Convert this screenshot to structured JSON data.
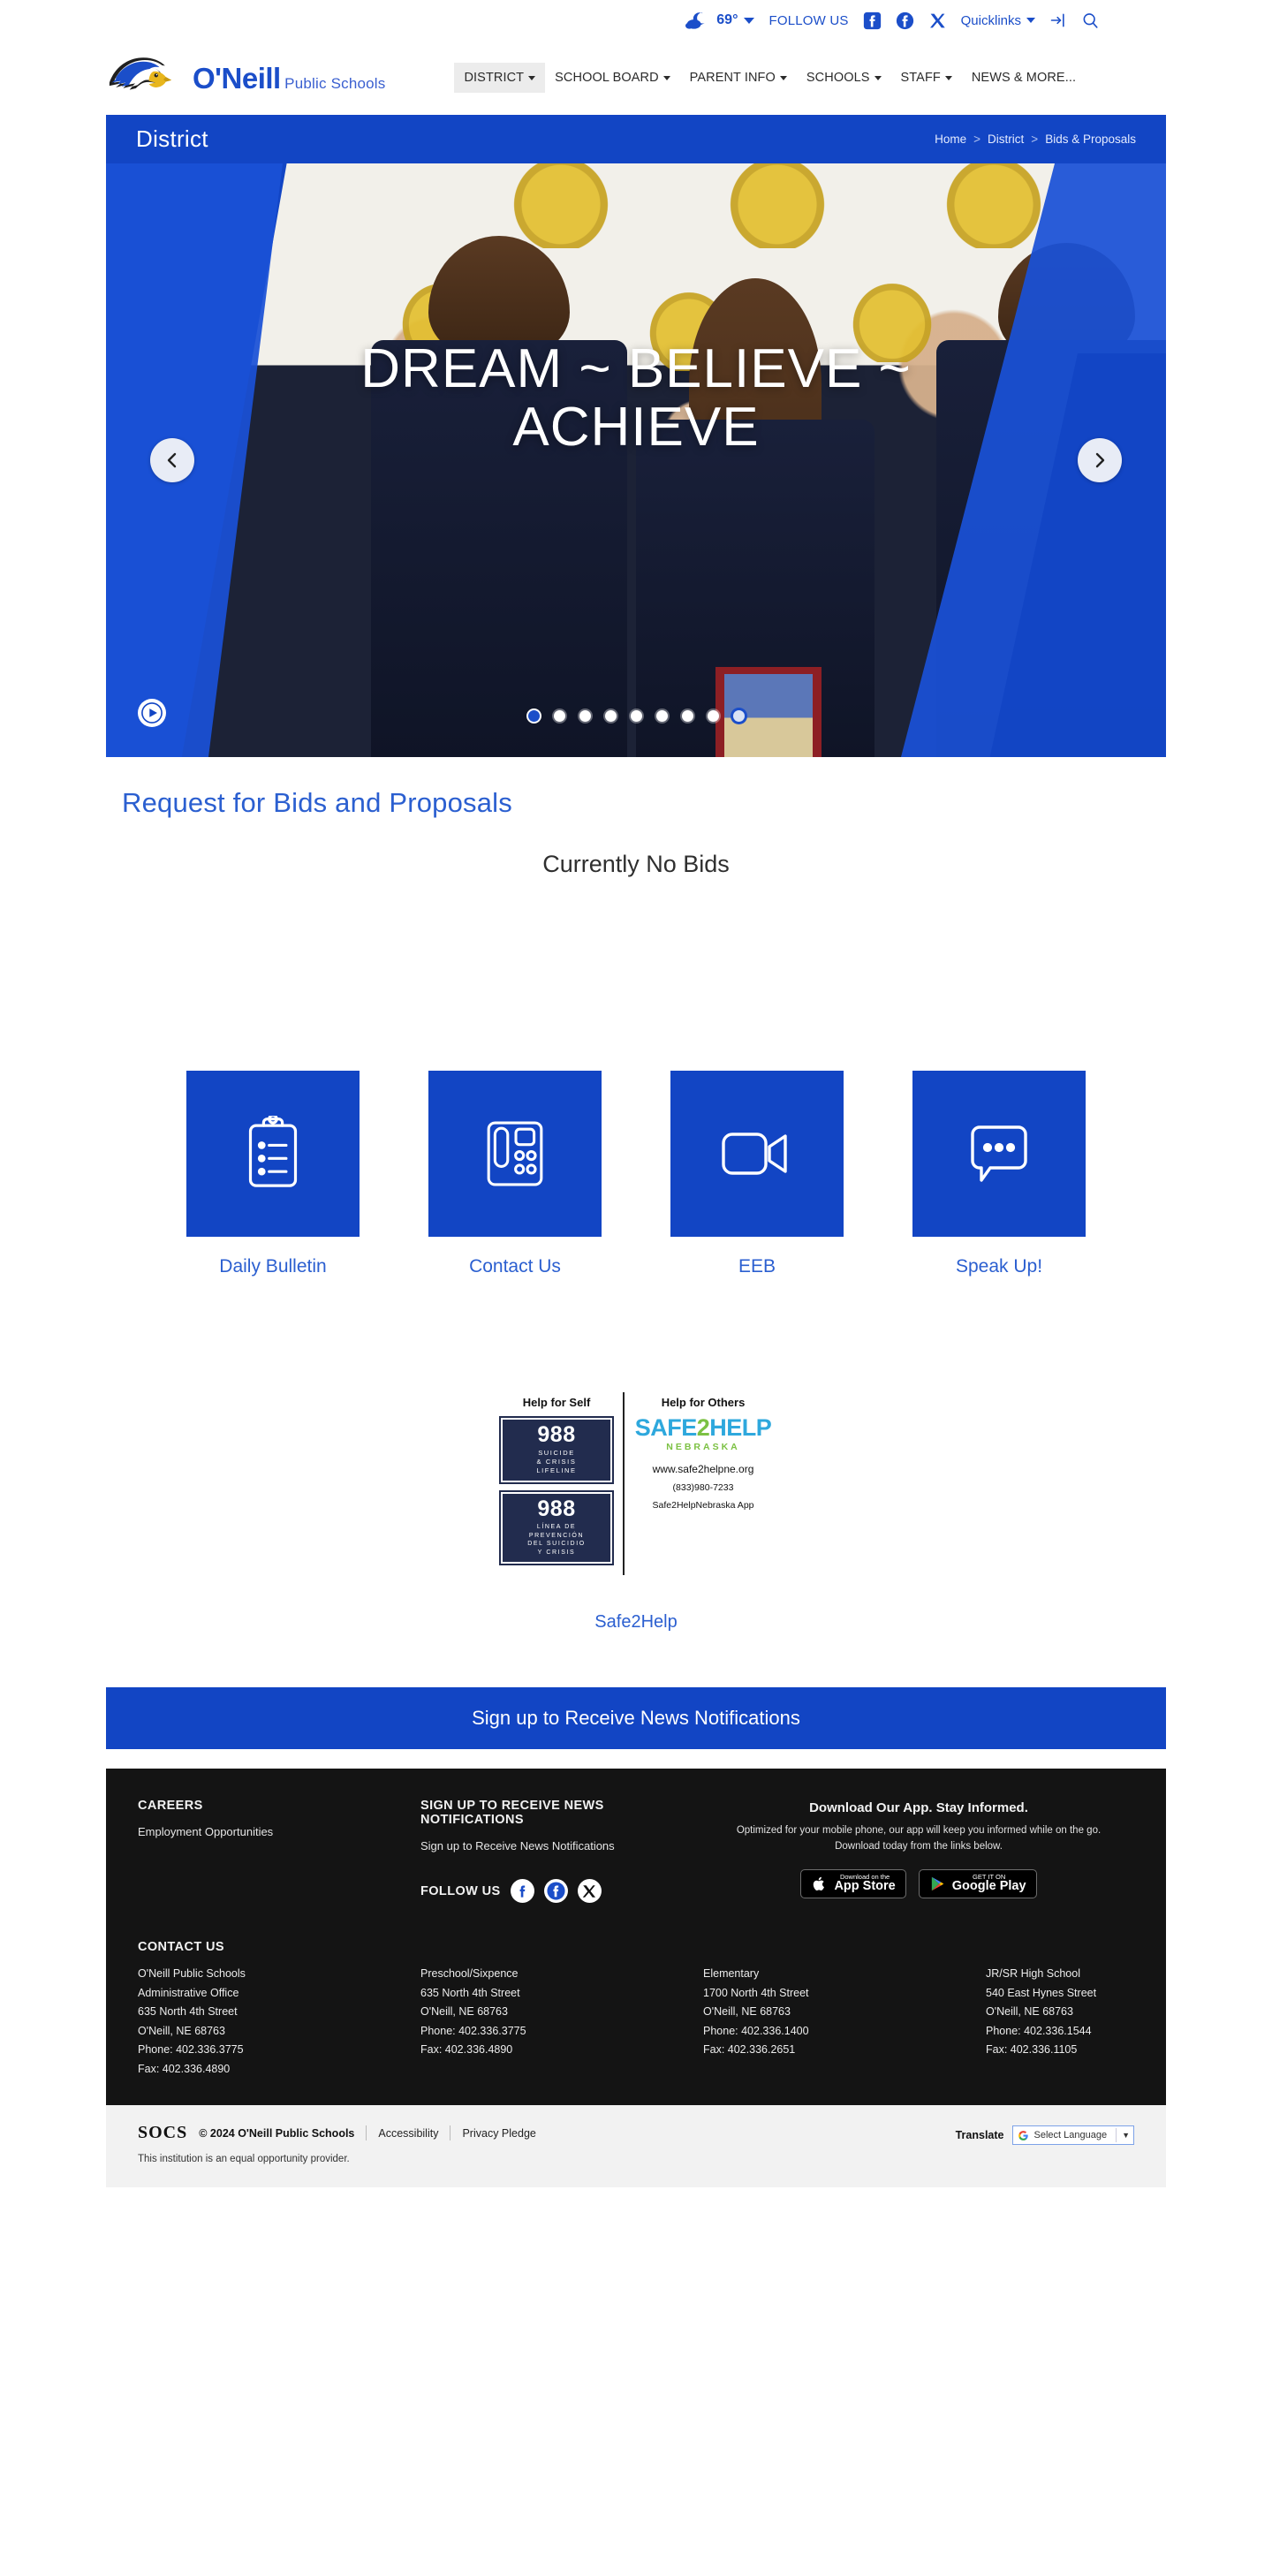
{
  "topbar": {
    "weather_temp": "69°",
    "weather_icon": "moon-cloud-icon",
    "follow_us": "FOLLOW US",
    "social": [
      {
        "name": "facebook-square-icon",
        "label": "Facebook"
      },
      {
        "name": "facebook-circle-icon",
        "label": "Facebook"
      },
      {
        "name": "x-twitter-icon",
        "label": "X"
      }
    ],
    "quicklinks": "Quicklinks",
    "login_icon": "sign-in-icon",
    "search_icon": "search-icon"
  },
  "brand": {
    "line1": "O'Neill",
    "line2": "Public Schools",
    "logo_icon": "eagle-head-logo"
  },
  "nav": [
    {
      "label": "DISTRICT",
      "has_caret": true,
      "active": true
    },
    {
      "label": "SCHOOL BOARD",
      "has_caret": true,
      "active": false
    },
    {
      "label": "PARENT INFO",
      "has_caret": true,
      "active": false
    },
    {
      "label": "SCHOOLS",
      "has_caret": true,
      "active": false
    },
    {
      "label": "STAFF",
      "has_caret": true,
      "active": false
    },
    {
      "label": "NEWS & MORE...",
      "has_caret": false,
      "active": false
    }
  ],
  "banner": {
    "title": "District",
    "breadcrumb": [
      "Home",
      "District",
      "Bids & Proposals"
    ],
    "separator": ">",
    "bg_color": "#1245c4"
  },
  "hero": {
    "caption": "DREAM ~ BELIEVE ~ ACHIEVE",
    "prev_icon": "chevron-left-icon",
    "next_icon": "chevron-right-icon",
    "play_icon": "play-icon",
    "dot_count": 9,
    "filled_index": 0,
    "current_index": 8
  },
  "main": {
    "heading": "Request for Bids and Proposals",
    "body": "Currently No Bids"
  },
  "cards": [
    {
      "label": "Daily Bulletin",
      "icon": "clipboard-icon"
    },
    {
      "label": "Contact Us",
      "icon": "desk-phone-icon"
    },
    {
      "label": "EEB",
      "icon": "video-camera-icon"
    },
    {
      "label": "Speak Up!",
      "icon": "speech-bubble-icon"
    }
  ],
  "safe2help": {
    "left_heading": "Help for Self",
    "right_heading": "Help for Others",
    "badge1_number": "988",
    "badge1_sub": "SUICIDE\n& CRISIS\nLIFELINE",
    "badge2_number": "988",
    "badge2_sub": "LÍNEA DE\nPREVENCIÓN\nDEL SUICIDIO\nY CRISIS",
    "logo_safe": "SAFE",
    "logo_two": "2",
    "logo_help": "HELP",
    "logo_state": "NEBRASKA",
    "url": "www.safe2helpne.org",
    "phone": "(833)980-7233",
    "app": "Safe2HelpNebraska App",
    "link_label": "Safe2Help"
  },
  "signup_bar": {
    "label": "Sign up to Receive News Notifications"
  },
  "footer": {
    "careers_heading": "CAREERS",
    "careers_link": "Employment Opportunities",
    "signup_heading": "SIGN UP TO RECEIVE NEWS NOTIFICATIONS",
    "signup_link": "Sign up to Receive News Notifications",
    "follow_label": "FOLLOW US",
    "social": [
      {
        "name": "facebook-f-icon",
        "label": "Facebook"
      },
      {
        "name": "facebook-circle-icon",
        "label": "Facebook"
      },
      {
        "name": "x-twitter-icon",
        "label": "X"
      }
    ],
    "app_heading": "Download Our App. Stay Informed.",
    "app_text": "Optimized for your mobile phone, our app will keep you informed while on the go. Download today from the links below.",
    "app_store_small": "Download on the",
    "app_store_big": "App Store",
    "google_small": "GET IT ON",
    "google_big": "Google Play",
    "contact_heading": "CONTACT US",
    "locations": [
      {
        "name": "O'Neill Public Schools",
        "line2": "Administrative Office",
        "street": "635 North 4th Street",
        "city": "O'Neill, NE  68763",
        "phone": "Phone: 402.336.3775",
        "fax": "Fax: 402.336.4890"
      },
      {
        "name": "Preschool/Sixpence",
        "line2": "",
        "street": "635 North 4th Street",
        "city": "O'Neill, NE  68763",
        "phone": "Phone: 402.336.3775",
        "fax": "Fax: 402.336.4890"
      },
      {
        "name": "Elementary",
        "line2": "",
        "street": "1700 North 4th Street",
        "city": "O'Neill, NE  68763",
        "phone": "Phone: 402.336.1400",
        "fax": "Fax: 402.336.2651"
      },
      {
        "name": "JR/SR High School",
        "line2": "",
        "street": "540 East Hynes Street",
        "city": "O'Neill, NE  68763",
        "phone": "Phone: 402.336.1544",
        "fax": "Fax: 402.336.1105"
      }
    ]
  },
  "bottombar": {
    "socs": "SOCS",
    "copyright": "© 2024 O'Neill Public Schools",
    "accessibility": "Accessibility",
    "privacy": "Privacy Pledge",
    "equal_opportunity": "This institution is an equal opportunity provider.",
    "translate_label": "Translate",
    "select_language": "Select Language",
    "google_icon": "google-g-icon"
  },
  "colors": {
    "brand_blue": "#1245c4",
    "link_blue": "#2b5fd0",
    "footer_dark": "#141414"
  }
}
